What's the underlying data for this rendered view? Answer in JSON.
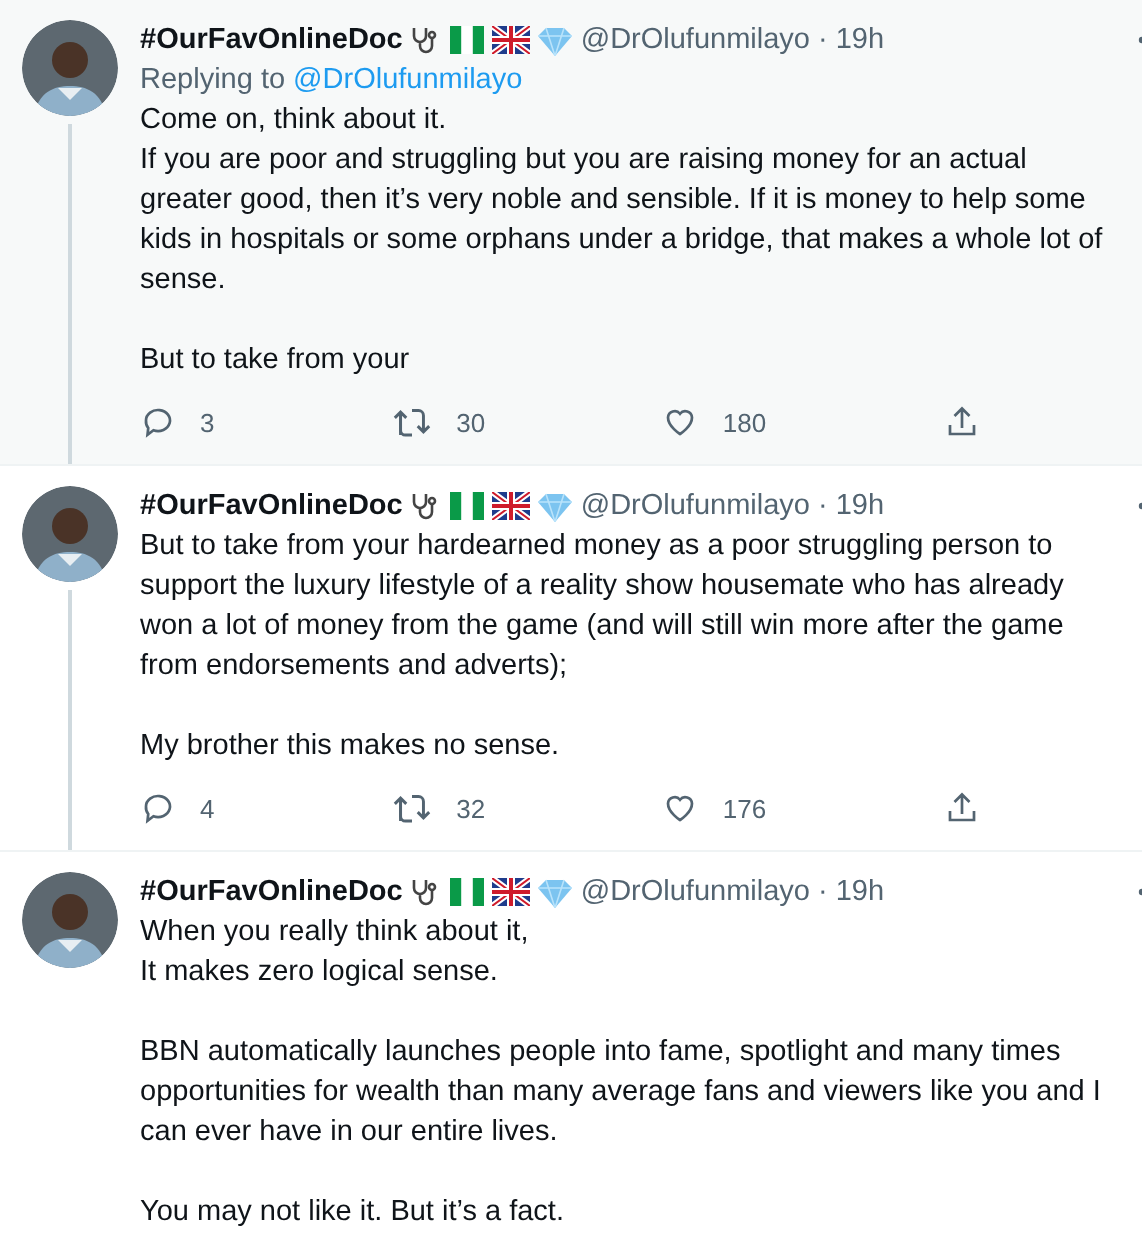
{
  "tweets": [
    {
      "highlighted": true,
      "thread_line": true,
      "name": "#OurFavOnlineDoc",
      "handle": "@DrOlufunmilayo",
      "separator": "·",
      "time": "19h",
      "replying_label": "Replying to",
      "replying_to": "@DrOlufunmilayo",
      "paragraphs": [
        "Come on, think about it.\nIf you are poor and struggling but you are raising money for an actual greater good, then it’s very noble and sensible. If it is money to help some kids in hospitals or some orphans under a bridge, that makes a whole lot of sense.",
        "But to take from your"
      ],
      "replies": "3",
      "retweets": "30",
      "likes": "180"
    },
    {
      "highlighted": false,
      "thread_line": true,
      "name": "#OurFavOnlineDoc",
      "handle": "@DrOlufunmilayo",
      "separator": "·",
      "time": "19h",
      "paragraphs": [
        "But to take from your hardearned money as a poor struggling person to support the luxury lifestyle of a reality show housemate who has already won a lot of money from the game (and will still win more after the game from endorsements and adverts);",
        "My brother this makes no sense."
      ],
      "replies": "4",
      "retweets": "32",
      "likes": "176"
    },
    {
      "highlighted": false,
      "thread_line": false,
      "name": "#OurFavOnlineDoc",
      "handle": "@DrOlufunmilayo",
      "separator": "·",
      "time": "19h",
      "paragraphs": [
        "When you really think about it,\nIt makes zero logical sense.",
        "BBN automatically launches people into fame, spotlight and many times opportunities for wealth than many average fans and viewers like you and I can ever have in our entire lives.",
        "You may not like it. But it’s a fact."
      ]
    }
  ]
}
